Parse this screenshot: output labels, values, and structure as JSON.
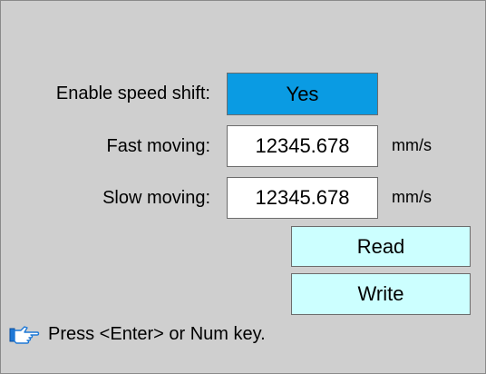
{
  "settings": {
    "enable_speed_shift_label": "Enable speed shift:",
    "enable_speed_shift_value": "Yes",
    "fast_moving_label": "Fast moving:",
    "fast_moving_value": "12345.678",
    "fast_moving_unit": "mm/s",
    "slow_moving_label": "Slow moving:",
    "slow_moving_value": "12345.678",
    "slow_moving_unit": "mm/s"
  },
  "buttons": {
    "read_label": "Read",
    "write_label": "Write"
  },
  "hint": {
    "icon": "pointing-hand-icon",
    "text": "Press <Enter> or Num key."
  },
  "colors": {
    "panel_background": "#cfcfcf",
    "toggle_selected": "#0a9be3",
    "button_background": "#ccffff",
    "field_background": "#ffffff"
  }
}
